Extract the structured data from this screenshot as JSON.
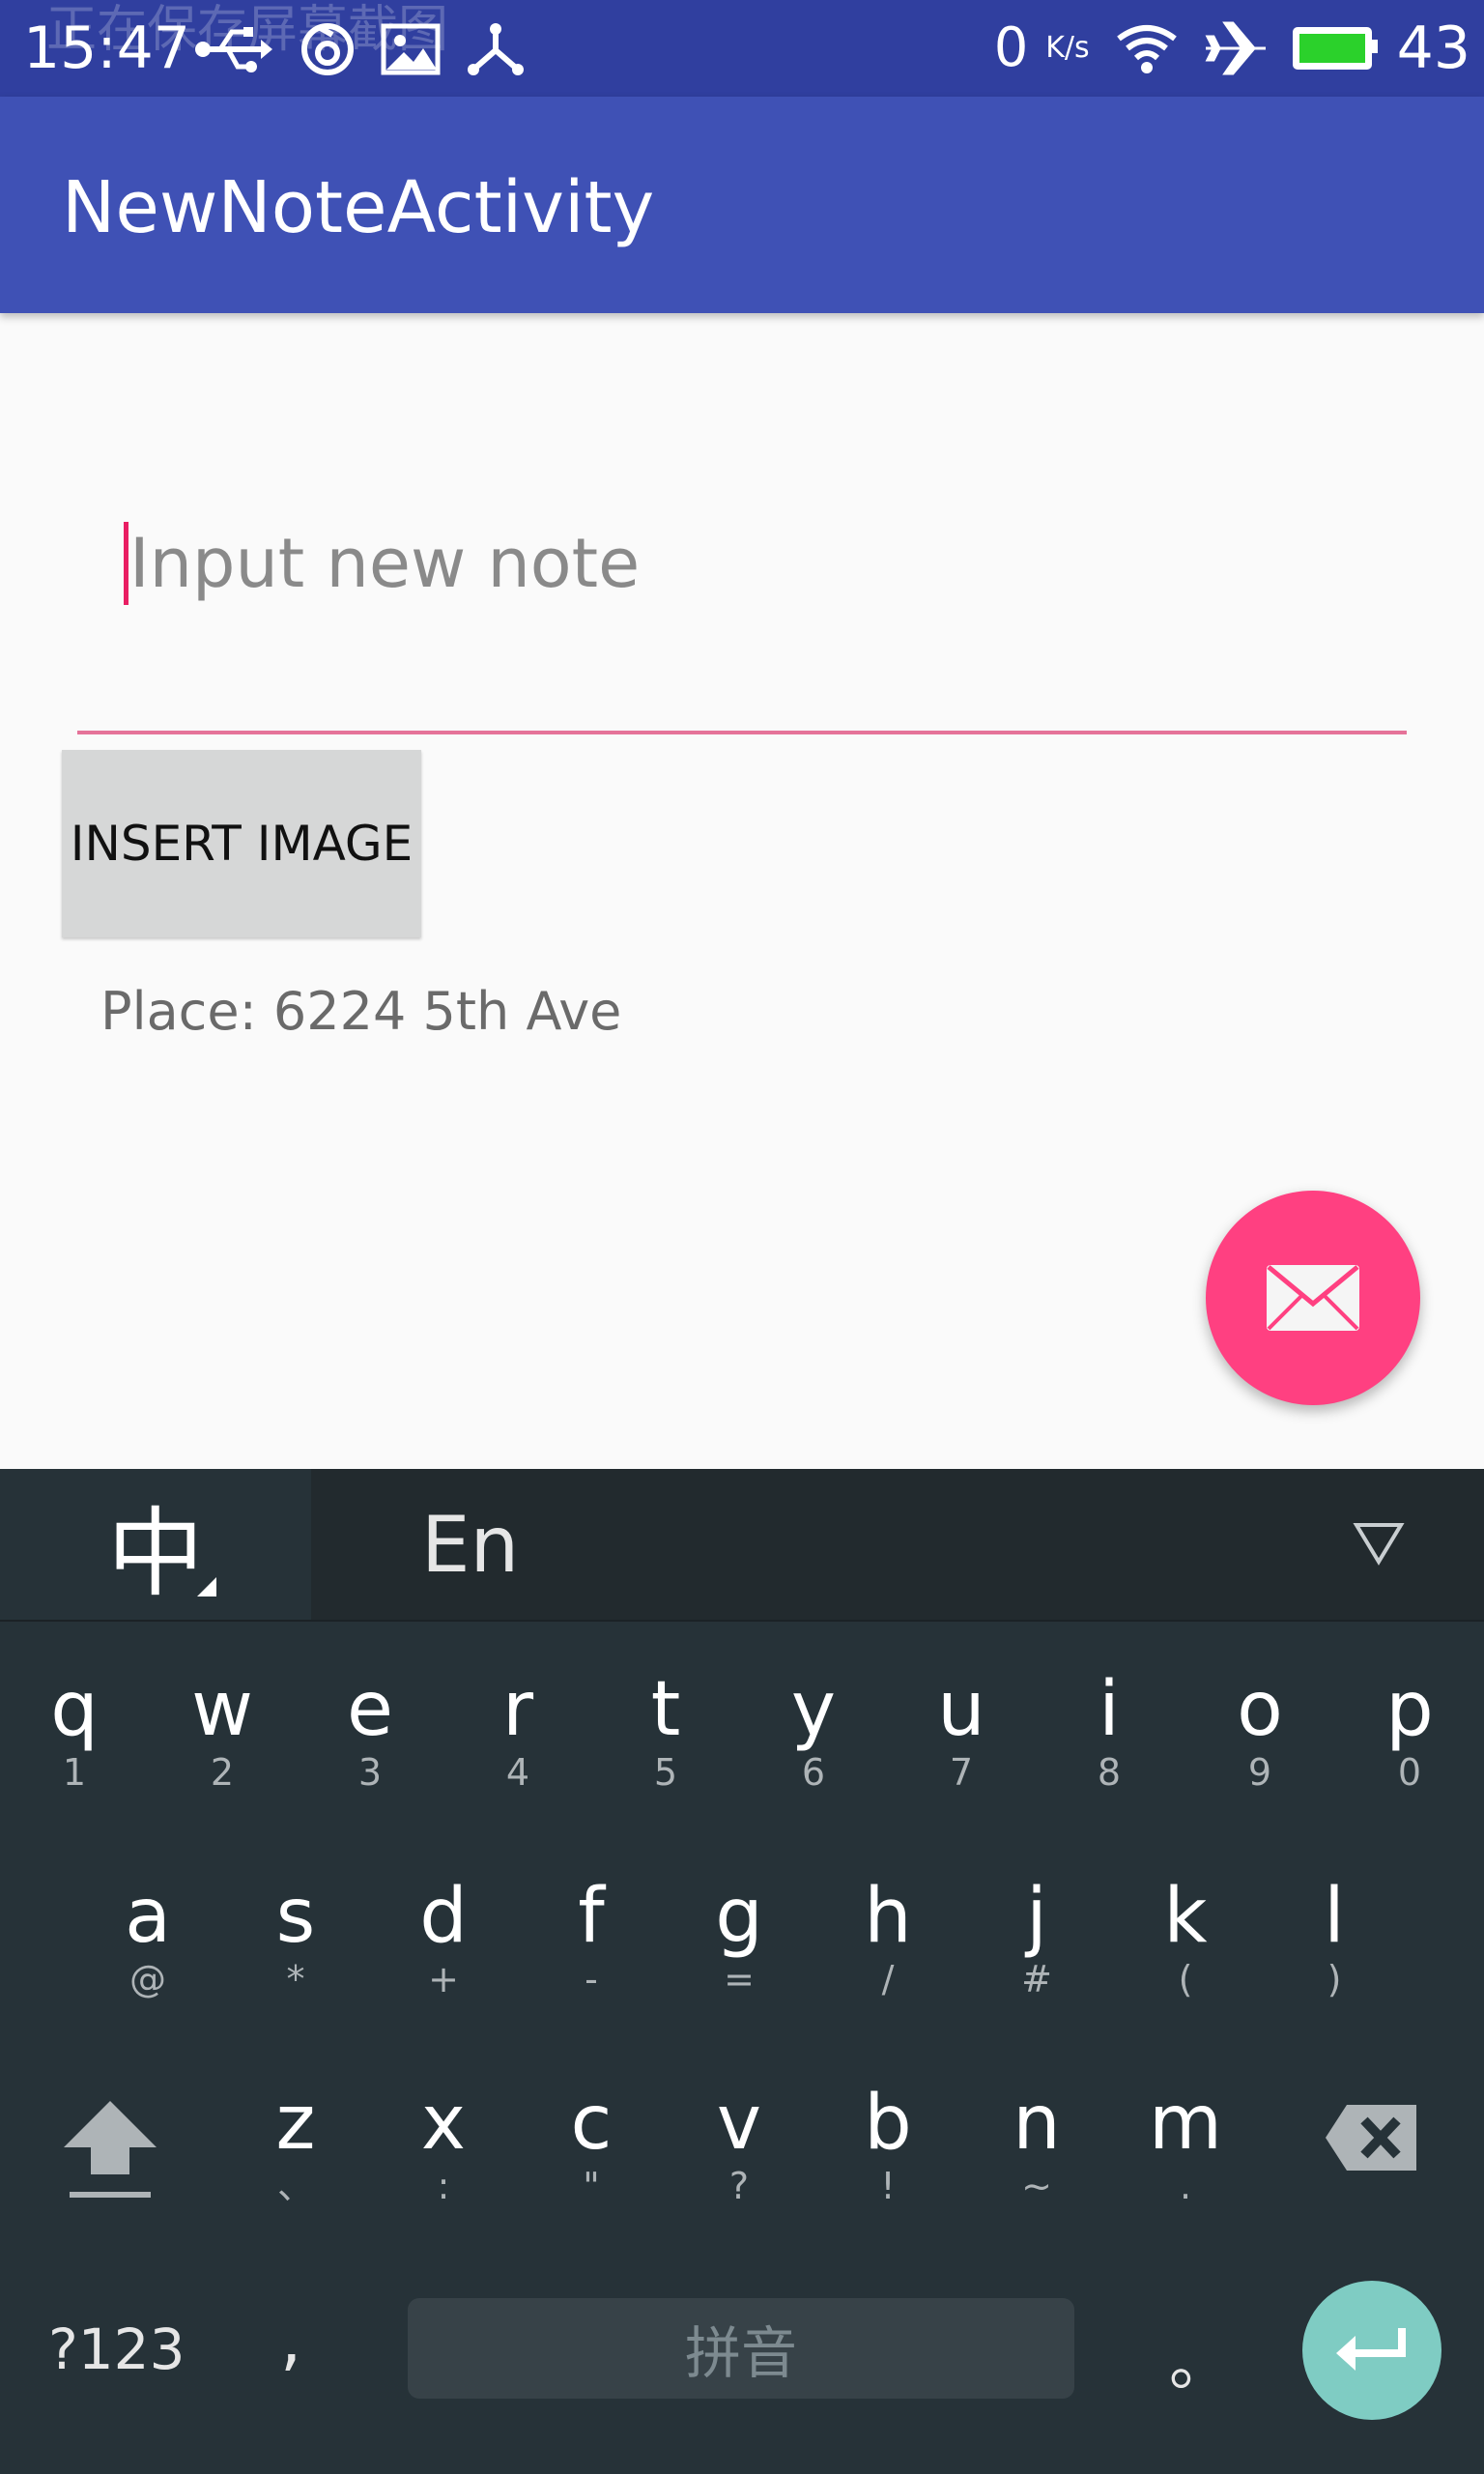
{
  "status_bar": {
    "time": "15:47",
    "overlay_notification": "正在保存屏幕截图",
    "net_speed_value": "0",
    "net_speed_unit": "K/s",
    "battery_level": "43",
    "icons": [
      "usb-icon",
      "sync-icon",
      "image-icon",
      "share-icon",
      "wifi-icon",
      "airplane-icon",
      "battery-icon"
    ]
  },
  "app_bar": {
    "title": "NewNoteActivity"
  },
  "note_input": {
    "placeholder": "Input new note",
    "value": ""
  },
  "insert_button": {
    "label": "INSERT IMAGE"
  },
  "place": {
    "text": "Place: 6224 5th Ave"
  },
  "fab": {
    "icon": "mail-icon"
  },
  "keyboard": {
    "lang_zh": "中",
    "lang_en": "En",
    "row1": [
      {
        "main": "q",
        "sub": "1"
      },
      {
        "main": "w",
        "sub": "2"
      },
      {
        "main": "e",
        "sub": "3"
      },
      {
        "main": "r",
        "sub": "4"
      },
      {
        "main": "t",
        "sub": "5"
      },
      {
        "main": "y",
        "sub": "6"
      },
      {
        "main": "u",
        "sub": "7"
      },
      {
        "main": "i",
        "sub": "8"
      },
      {
        "main": "o",
        "sub": "9"
      },
      {
        "main": "p",
        "sub": "0"
      }
    ],
    "row2": [
      {
        "main": "a",
        "sub": "@"
      },
      {
        "main": "s",
        "sub": "*"
      },
      {
        "main": "d",
        "sub": "+"
      },
      {
        "main": "f",
        "sub": "-"
      },
      {
        "main": "g",
        "sub": "="
      },
      {
        "main": "h",
        "sub": "/"
      },
      {
        "main": "j",
        "sub": "#"
      },
      {
        "main": "k",
        "sub": "("
      },
      {
        "main": "l",
        "sub": ")"
      }
    ],
    "row3": [
      {
        "main": "z",
        "sub": "、"
      },
      {
        "main": "x",
        "sub": ":"
      },
      {
        "main": "c",
        "sub": "\""
      },
      {
        "main": "v",
        "sub": "?"
      },
      {
        "main": "b",
        "sub": "!"
      },
      {
        "main": "n",
        "sub": "~"
      },
      {
        "main": "m",
        "sub": "."
      }
    ],
    "symbols": "?123",
    "comma": ",",
    "space": "拼音",
    "period": "。"
  },
  "colors": {
    "status_bar": "#303f9f",
    "app_bar": "#3f51b5",
    "accent": "#ff4081",
    "keyboard_bg": "#263238",
    "enter_key": "#7fccc3"
  }
}
